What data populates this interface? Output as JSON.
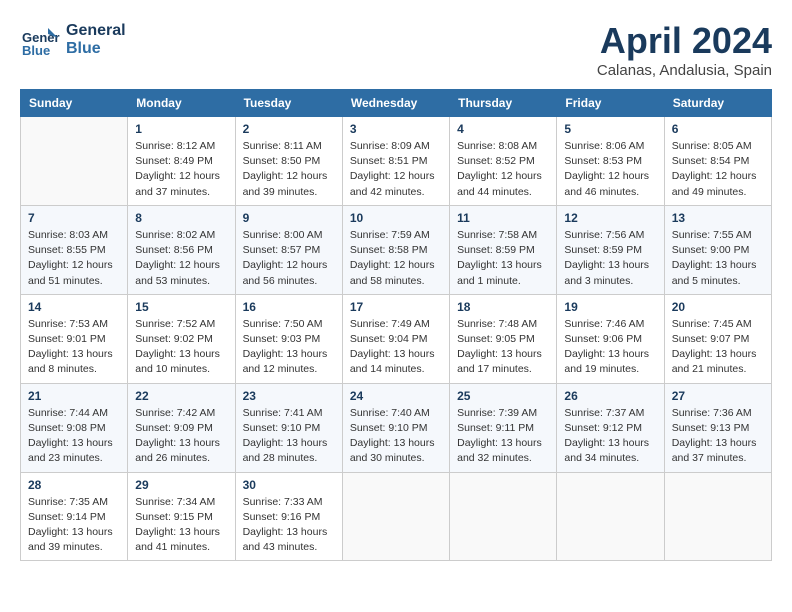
{
  "header": {
    "logo_line1": "General",
    "logo_line2": "Blue",
    "month_year": "April 2024",
    "location": "Calanas, Andalusia, Spain"
  },
  "columns": [
    "Sunday",
    "Monday",
    "Tuesday",
    "Wednesday",
    "Thursday",
    "Friday",
    "Saturday"
  ],
  "weeks": [
    [
      {
        "day": "",
        "info": ""
      },
      {
        "day": "1",
        "info": "Sunrise: 8:12 AM\nSunset: 8:49 PM\nDaylight: 12 hours\nand 37 minutes."
      },
      {
        "day": "2",
        "info": "Sunrise: 8:11 AM\nSunset: 8:50 PM\nDaylight: 12 hours\nand 39 minutes."
      },
      {
        "day": "3",
        "info": "Sunrise: 8:09 AM\nSunset: 8:51 PM\nDaylight: 12 hours\nand 42 minutes."
      },
      {
        "day": "4",
        "info": "Sunrise: 8:08 AM\nSunset: 8:52 PM\nDaylight: 12 hours\nand 44 minutes."
      },
      {
        "day": "5",
        "info": "Sunrise: 8:06 AM\nSunset: 8:53 PM\nDaylight: 12 hours\nand 46 minutes."
      },
      {
        "day": "6",
        "info": "Sunrise: 8:05 AM\nSunset: 8:54 PM\nDaylight: 12 hours\nand 49 minutes."
      }
    ],
    [
      {
        "day": "7",
        "info": "Sunrise: 8:03 AM\nSunset: 8:55 PM\nDaylight: 12 hours\nand 51 minutes."
      },
      {
        "day": "8",
        "info": "Sunrise: 8:02 AM\nSunset: 8:56 PM\nDaylight: 12 hours\nand 53 minutes."
      },
      {
        "day": "9",
        "info": "Sunrise: 8:00 AM\nSunset: 8:57 PM\nDaylight: 12 hours\nand 56 minutes."
      },
      {
        "day": "10",
        "info": "Sunrise: 7:59 AM\nSunset: 8:58 PM\nDaylight: 12 hours\nand 58 minutes."
      },
      {
        "day": "11",
        "info": "Sunrise: 7:58 AM\nSunset: 8:59 PM\nDaylight: 13 hours\nand 1 minute."
      },
      {
        "day": "12",
        "info": "Sunrise: 7:56 AM\nSunset: 8:59 PM\nDaylight: 13 hours\nand 3 minutes."
      },
      {
        "day": "13",
        "info": "Sunrise: 7:55 AM\nSunset: 9:00 PM\nDaylight: 13 hours\nand 5 minutes."
      }
    ],
    [
      {
        "day": "14",
        "info": "Sunrise: 7:53 AM\nSunset: 9:01 PM\nDaylight: 13 hours\nand 8 minutes."
      },
      {
        "day": "15",
        "info": "Sunrise: 7:52 AM\nSunset: 9:02 PM\nDaylight: 13 hours\nand 10 minutes."
      },
      {
        "day": "16",
        "info": "Sunrise: 7:50 AM\nSunset: 9:03 PM\nDaylight: 13 hours\nand 12 minutes."
      },
      {
        "day": "17",
        "info": "Sunrise: 7:49 AM\nSunset: 9:04 PM\nDaylight: 13 hours\nand 14 minutes."
      },
      {
        "day": "18",
        "info": "Sunrise: 7:48 AM\nSunset: 9:05 PM\nDaylight: 13 hours\nand 17 minutes."
      },
      {
        "day": "19",
        "info": "Sunrise: 7:46 AM\nSunset: 9:06 PM\nDaylight: 13 hours\nand 19 minutes."
      },
      {
        "day": "20",
        "info": "Sunrise: 7:45 AM\nSunset: 9:07 PM\nDaylight: 13 hours\nand 21 minutes."
      }
    ],
    [
      {
        "day": "21",
        "info": "Sunrise: 7:44 AM\nSunset: 9:08 PM\nDaylight: 13 hours\nand 23 minutes."
      },
      {
        "day": "22",
        "info": "Sunrise: 7:42 AM\nSunset: 9:09 PM\nDaylight: 13 hours\nand 26 minutes."
      },
      {
        "day": "23",
        "info": "Sunrise: 7:41 AM\nSunset: 9:10 PM\nDaylight: 13 hours\nand 28 minutes."
      },
      {
        "day": "24",
        "info": "Sunrise: 7:40 AM\nSunset: 9:10 PM\nDaylight: 13 hours\nand 30 minutes."
      },
      {
        "day": "25",
        "info": "Sunrise: 7:39 AM\nSunset: 9:11 PM\nDaylight: 13 hours\nand 32 minutes."
      },
      {
        "day": "26",
        "info": "Sunrise: 7:37 AM\nSunset: 9:12 PM\nDaylight: 13 hours\nand 34 minutes."
      },
      {
        "day": "27",
        "info": "Sunrise: 7:36 AM\nSunset: 9:13 PM\nDaylight: 13 hours\nand 37 minutes."
      }
    ],
    [
      {
        "day": "28",
        "info": "Sunrise: 7:35 AM\nSunset: 9:14 PM\nDaylight: 13 hours\nand 39 minutes."
      },
      {
        "day": "29",
        "info": "Sunrise: 7:34 AM\nSunset: 9:15 PM\nDaylight: 13 hours\nand 41 minutes."
      },
      {
        "day": "30",
        "info": "Sunrise: 7:33 AM\nSunset: 9:16 PM\nDaylight: 13 hours\nand 43 minutes."
      },
      {
        "day": "",
        "info": ""
      },
      {
        "day": "",
        "info": ""
      },
      {
        "day": "",
        "info": ""
      },
      {
        "day": "",
        "info": ""
      }
    ]
  ]
}
